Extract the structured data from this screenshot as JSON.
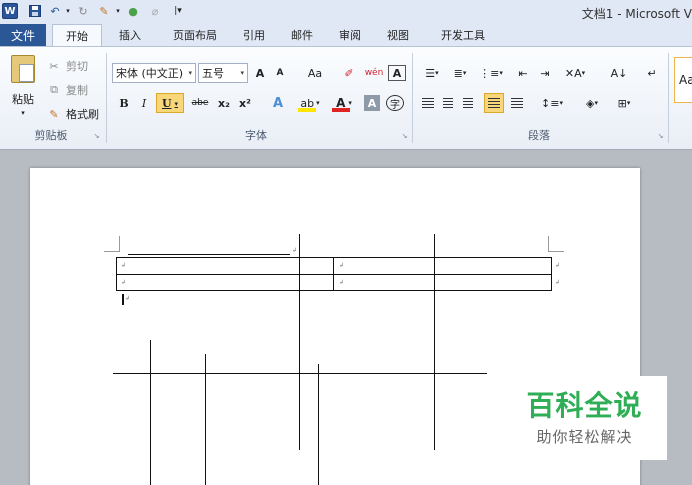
{
  "window": {
    "title": "文档1 - Microsoft V",
    "app_logo": "W"
  },
  "quick_access": {
    "save_icon": "save-icon",
    "undo_icon": "undo-icon",
    "redo_icon": "redo-icon",
    "format_icon": "format-painter-icon",
    "color_icon": "color-icon",
    "dropdown_glyph": "▾",
    "customize_glyph": "|▾"
  },
  "tabs": {
    "file": "文件",
    "home": "开始",
    "insert": "插入",
    "layout": "页面布局",
    "references": "引用",
    "mailings": "邮件",
    "review": "审阅",
    "view": "视图",
    "developer": "开发工具"
  },
  "clipboard": {
    "paste": "粘贴",
    "cut": "剪切",
    "copy": "复制",
    "format_painter": "格式刷",
    "group_label": "剪贴板"
  },
  "font": {
    "name": "宋体 (中文正)",
    "size": "五号",
    "grow": "A",
    "shrink": "A",
    "change_case": "Aa",
    "clear_format": "♔",
    "phonetic": "wén",
    "char_border": "A",
    "bold": "B",
    "italic": "I",
    "underline": "U",
    "strikethrough": "abe",
    "subscript": "x₂",
    "superscript": "x²",
    "text_effect": "A",
    "highlight": "ab",
    "font_color": "A",
    "char_shading": "A",
    "enclose": "字",
    "group_label": "字体",
    "highlight_color": "#ffe600",
    "font_color_value": "#e02424"
  },
  "paragraph": {
    "sort": "A↓",
    "show_marks": "↵",
    "group_label": "段落",
    "multilevel": "⋮≡",
    "chinese_layout": "✕A"
  },
  "styles": {
    "preview": "Aa"
  },
  "document": {
    "cell_mark": "↲",
    "para_mark": "↲"
  },
  "watermark": {
    "title": "百科全说",
    "subtitle": "助你轻松解决",
    "color": "#2fae56"
  }
}
